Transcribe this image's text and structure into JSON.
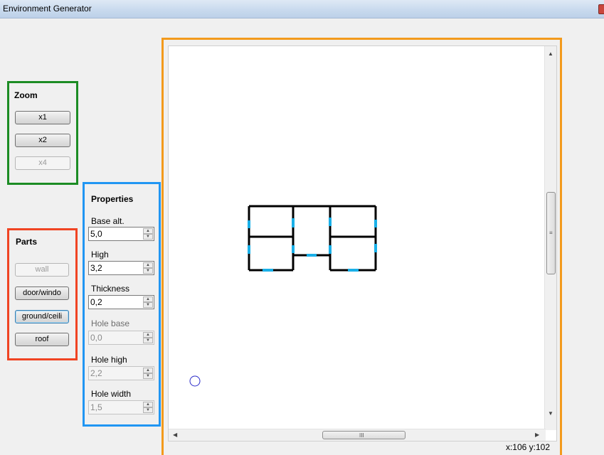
{
  "window": {
    "title": "Environment Generator"
  },
  "zoom": {
    "title": "Zoom",
    "buttons": [
      "x1",
      "x2",
      "x4"
    ]
  },
  "parts": {
    "title": "Parts",
    "buttons": [
      "wall",
      "door/windo",
      "ground/ceili",
      "roof"
    ]
  },
  "properties": {
    "title": "Properties",
    "fields": [
      {
        "label": "Base alt.",
        "value": "5,0",
        "enabled": true
      },
      {
        "label": "High",
        "value": "3,2",
        "enabled": true
      },
      {
        "label": "Thickness",
        "value": "0,2",
        "enabled": true
      },
      {
        "label": "Hole base",
        "value": "0,0",
        "enabled": false
      },
      {
        "label": "Hole high",
        "value": "2,2",
        "enabled": false
      },
      {
        "label": "Hole width",
        "value": "1,5",
        "enabled": false
      }
    ]
  },
  "canvas": {
    "coords": "x:106 y:102"
  },
  "colors": {
    "wall": "#000000",
    "opening": "#1ab0e8",
    "cursor": "#2a2ac8"
  },
  "icons": {
    "scroll_up": "▲",
    "scroll_down": "▼",
    "scroll_left": "◀",
    "scroll_right": "▶",
    "vgrip": "≡",
    "hgrip": "III"
  }
}
